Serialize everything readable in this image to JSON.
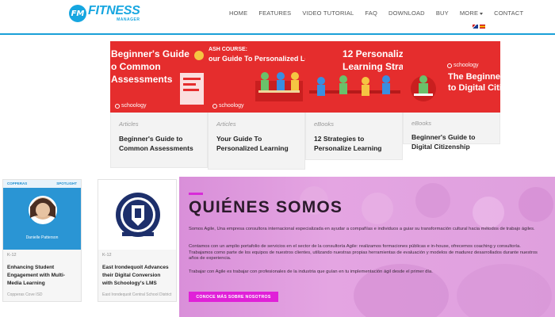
{
  "logo": {
    "badge": "FM",
    "title": "FITNESS",
    "subtitle": "MANAGER"
  },
  "nav": {
    "items": [
      "HOME",
      "FEATURES",
      "VIDEO TUTORIAL",
      "FAQ",
      "DOWNLOAD",
      "BUY",
      "MORE",
      "CONTACT"
    ]
  },
  "cards": [
    {
      "image_text_lines": [
        "Beginner's Guide",
        "o Common",
        "Assessments"
      ],
      "brand": "schoology",
      "category": "Articles",
      "title": "Beginner's Guide to Common Assessments"
    },
    {
      "image_text_lines": [
        "ASH COURSE:",
        "our Guide To Personalized Le"
      ],
      "brand": "schoology",
      "category": "Articles",
      "title": "Your Guide To Personalized Learning"
    },
    {
      "image_text_lines": [
        "12 Personaliz",
        "Learning Stra"
      ],
      "brand": "",
      "category": "eBooks",
      "title": "12 Strategies to Personalize Learning"
    },
    {
      "image_text_lines": [
        "The Beginner's",
        "to Digital Citiz"
      ],
      "brand": "schoology",
      "category": "eBooks",
      "title": "Beginner's Guide to Digital Citizenship"
    }
  ],
  "bottom_cards": [
    {
      "badge_left": "COPPERAS",
      "badge_right": "SPOTLIGHT",
      "person": "Danielle Patterson",
      "grade": "K-12",
      "title": "Enhancing Student Engagement with Multi-Media Learning",
      "source": "Copperas Cove ISD"
    },
    {
      "grade": "K-12",
      "title": "East Irondequoit Advances their Digital Conversion with Schoology's LMS",
      "source": "East Irondequoit Central School District"
    }
  ],
  "about": {
    "title": "QUIÉNES SOMOS",
    "p1": "Somos Agile, Una empresa consultora internacional especializada en ayudar a compañías e individuos a guiar su transformación cultural hacia métodos de trabajo ágiles.",
    "p2": "Contamos con un amplio portafolio de servicios en el sector de la consultoría Agile: realizamos formaciones públicas e in-house, ofrecemos coaching y consultoría. Trabajamos como parte de los equipos de nuestros clientes, utilizando nuestras propias herramientas de evaluación y modelos de madurez desarrollados durante nuestros años de experiencia.",
    "p3": "Trabajar con Agile es trabajar con profesionales de la industria que guían en tu implementación ágil desde el primer día.",
    "button": "CONOCE MÁS SOBRE NOSOTROS"
  },
  "colors": {
    "brand_blue": "#16a6e0",
    "card_red": "#e52d2d",
    "about_bg": "#e4a5e2",
    "accent_magenta": "#e020d8"
  }
}
